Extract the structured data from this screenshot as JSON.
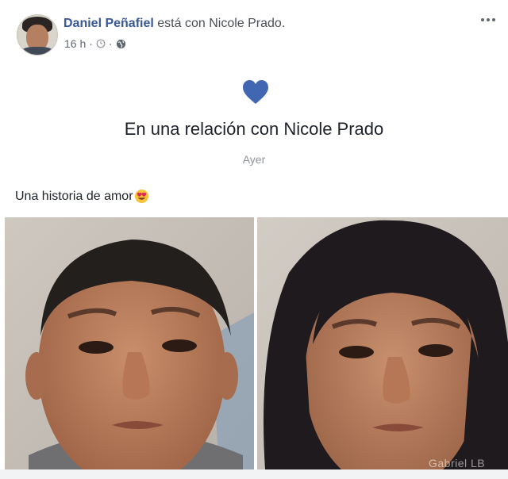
{
  "post": {
    "author": "Daniel Peñafiel",
    "with_text": "está con",
    "tagged": "Nicole Prado.",
    "time": "16 h",
    "separator": "·",
    "icons": [
      "clock-icon",
      "globe-icon",
      "more-options-icon",
      "heart-icon",
      "heart-eyes-emoji"
    ]
  },
  "life_event": {
    "title": "En una relación con Nicole Prado",
    "date": "Ayer",
    "heart_color": "#4267b2"
  },
  "caption": {
    "text": "Una historia de amor"
  },
  "photos": {
    "watermark": "Gabriel LB"
  },
  "colors": {
    "link": "#385898",
    "text": "#1d2129",
    "muted": "#90949c"
  }
}
